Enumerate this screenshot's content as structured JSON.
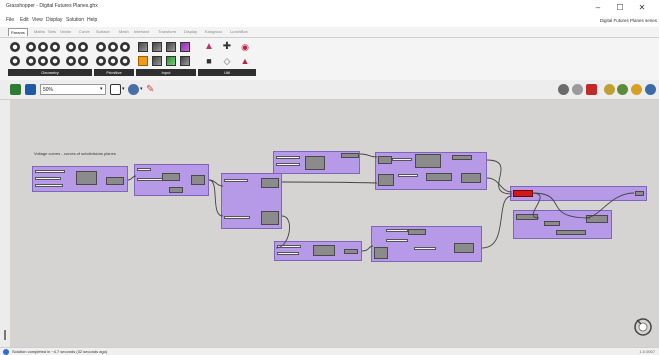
{
  "window": {
    "title": "Grasshopper - Digital Futures Planes.ghx",
    "minimize": "–",
    "maximize": "☐",
    "close": "✕"
  },
  "menu": {
    "items": [
      "File",
      "Edit",
      "View",
      "Display",
      "Solution",
      "Help"
    ],
    "document_name": "Digital Futures Planes series"
  },
  "tabs": {
    "items": [
      "Params",
      "Maths",
      "Sets",
      "Vector",
      "Curve",
      "Surface",
      "Mesh",
      "Intersect",
      "Transform",
      "Display",
      "Kangaroo",
      "LunchBox"
    ],
    "active": "Params"
  },
  "ribbon": {
    "groups": [
      "Geometry",
      "Primitive",
      "Input",
      "Util"
    ]
  },
  "canvas_toolbar": {
    "zoom_value": "50%"
  },
  "canvas": {
    "group_label": "Voltage curves - curves of subdivisions planes"
  },
  "status": {
    "text": "Solution completed in ~4.7 seconds (32 seconds ago)",
    "right": "1.0.0007"
  },
  "colors": {
    "canvas_bg": "#d6d4d3",
    "group_fill": "#ae8cec",
    "component": "#8b8b8b",
    "error_component": "#d01818"
  }
}
